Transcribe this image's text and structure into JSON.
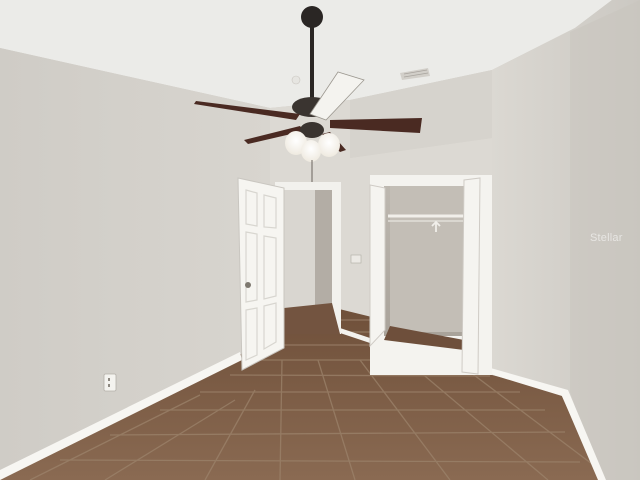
{
  "photo": {
    "subject": "empty-bedroom-with-ceiling-fan-and-open-closet",
    "watermark_text": "Stellar",
    "colors": {
      "ceiling": "#ebebe8",
      "wall_left": "#d3d0ca",
      "wall_right": "#d9d6d0",
      "wall_back": "#dcd9d3",
      "trim": "#f7f6f2",
      "floor_tile": "#7e5c43",
      "grout": "#9a8066",
      "fan_blade": "#4a2a22",
      "fan_body": "#2a2624"
    }
  }
}
